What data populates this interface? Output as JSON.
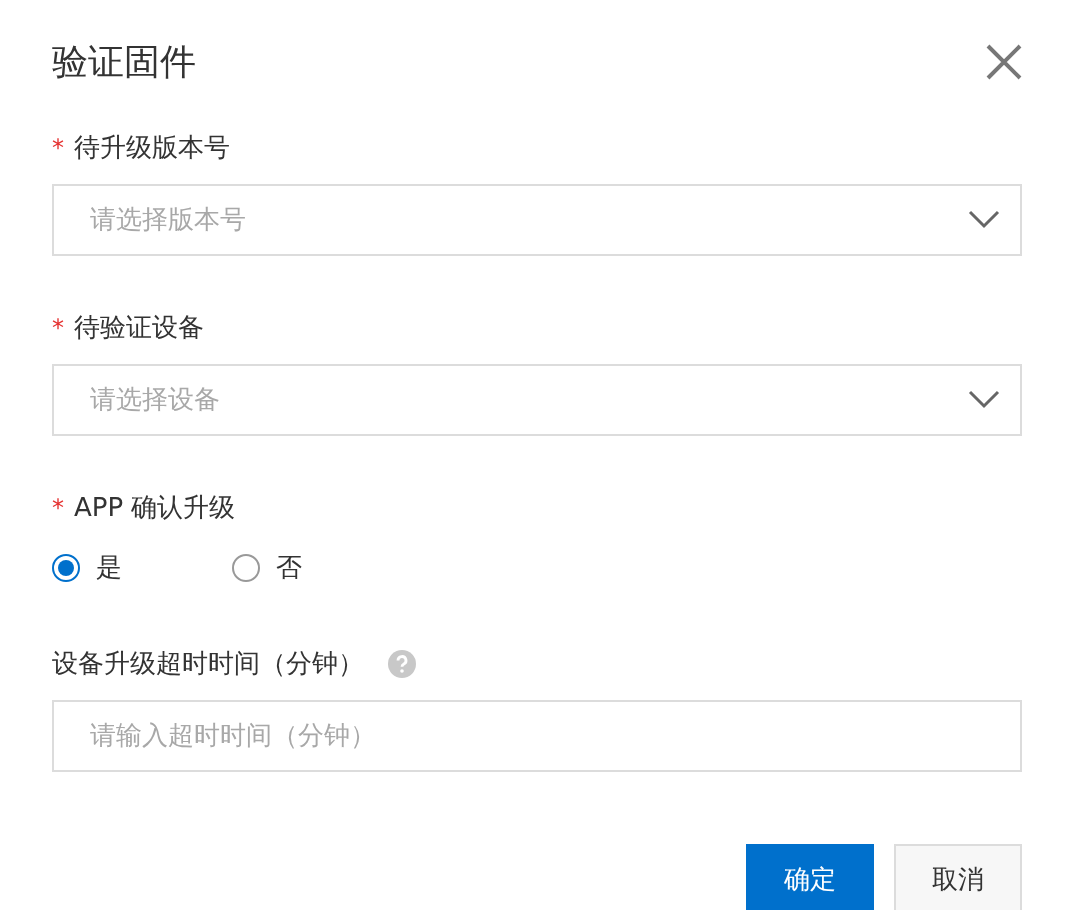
{
  "dialog": {
    "title": "验证固件"
  },
  "fields": [
    {
      "kind": "select",
      "mark": "*",
      "label": "待升级版本号",
      "placeholder": "请选择版本号"
    },
    {
      "kind": "select",
      "mark": "*",
      "label": "待验证设备",
      "placeholder": "请选择设备"
    },
    {
      "kind": "radio",
      "mark": "*",
      "label": "APP 确认升级",
      "options": [
        {
          "label": "是",
          "selected": true
        },
        {
          "label": "否",
          "selected": false
        }
      ]
    },
    {
      "kind": "input",
      "label": "设备升级超时时间（分钟）",
      "help": true,
      "placeholder": "请输入超时时间（分钟）"
    }
  ],
  "buttons": [
    {
      "label": "确定",
      "kind": "primary"
    },
    {
      "label": "取消",
      "kind": "secondary"
    }
  ]
}
